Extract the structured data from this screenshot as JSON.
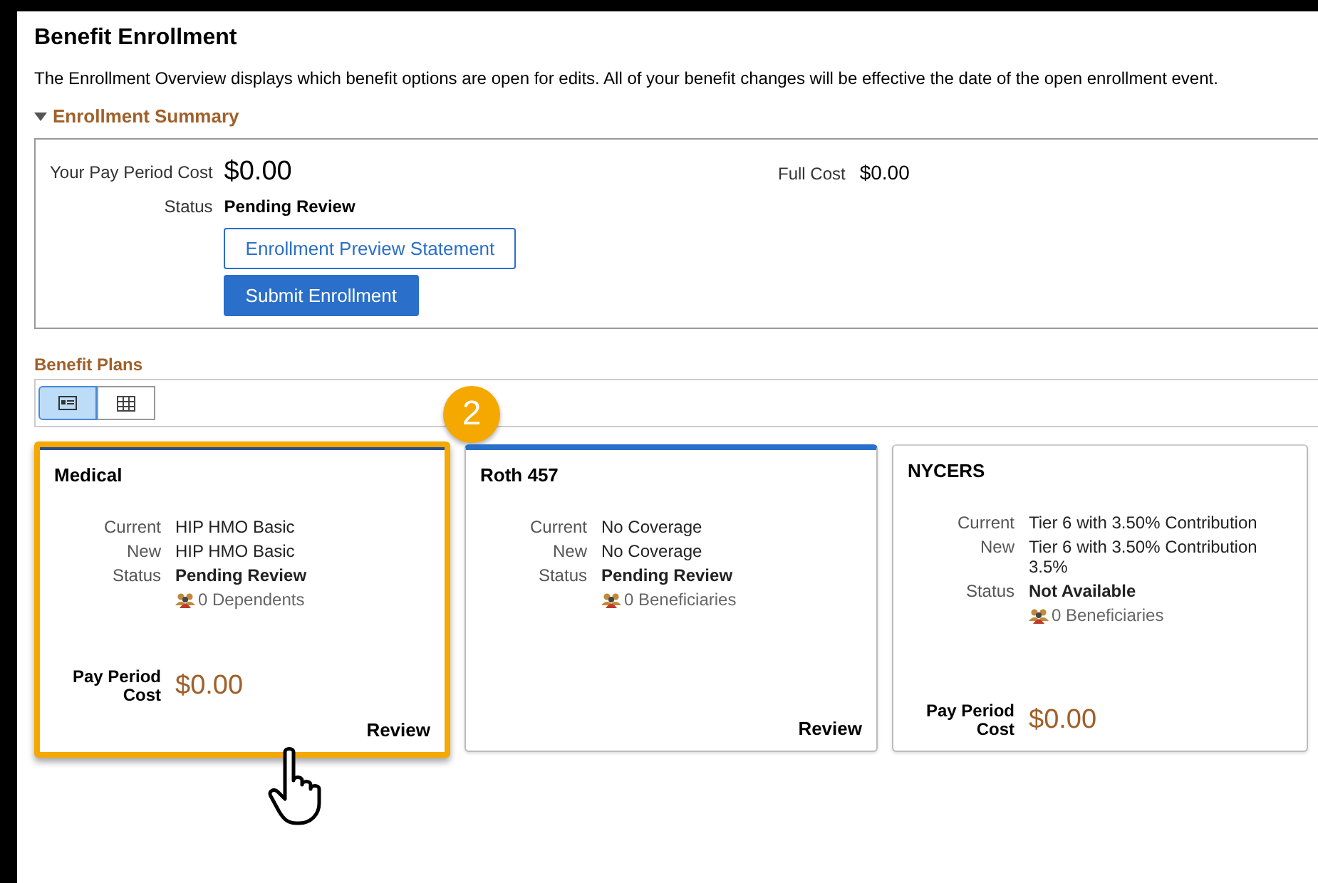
{
  "page": {
    "title": "Benefit Enrollment",
    "description": "The Enrollment Overview displays which benefit options are open for edits. All of your benefit changes will be effective the date of the open enrollment event."
  },
  "summary": {
    "title": "Enrollment Summary",
    "expanded": true,
    "pay_period_cost_label": "Your Pay Period Cost",
    "pay_period_cost": "$0.00",
    "full_cost_label": "Full Cost",
    "full_cost": "$0.00",
    "status_label": "Status",
    "status": "Pending Review",
    "buttons": [
      {
        "label": "Enrollment Preview Statement",
        "kind": "secondary"
      },
      {
        "label": "Submit Enrollment",
        "kind": "primary"
      }
    ]
  },
  "plans": {
    "title": "Benefit Plans",
    "views": [
      {
        "kind": "cards",
        "selected": true
      },
      {
        "kind": "grid",
        "selected": false
      }
    ],
    "callout": "2",
    "cards": [
      {
        "title": "Medical",
        "accent": true,
        "highlighted": true,
        "current_label": "Current",
        "current": "HIP HMO Basic",
        "new_label": "New",
        "new": "HIP HMO Basic",
        "status_label": "Status",
        "status": "Pending Review",
        "people": "0 Dependents",
        "cost_label": "Pay Period Cost",
        "cost": "$0.00",
        "action": "Review"
      },
      {
        "title": "Roth 457",
        "accent": true,
        "highlighted": false,
        "current_label": "Current",
        "current": "No Coverage",
        "new_label": "New",
        "new": "No Coverage",
        "status_label": "Status",
        "status": "Pending Review",
        "people": "0 Beneficiaries",
        "action": "Review"
      },
      {
        "title": "NYCERS",
        "accent": false,
        "highlighted": false,
        "current_label": "Current",
        "current": "Tier 6 with 3.50% Contribution",
        "new_label": "New",
        "new": "Tier 6 with 3.50% Contribution 3.5%",
        "status_label": "Status",
        "status": "Not Available",
        "people": "0 Beneficiaries",
        "cost_label": "Pay Period Cost",
        "cost": "$0.00"
      }
    ]
  }
}
